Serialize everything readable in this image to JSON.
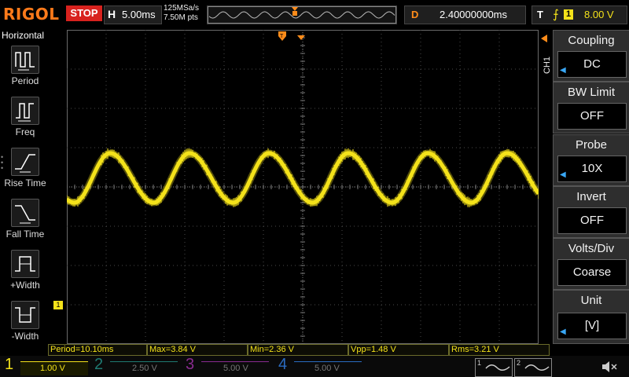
{
  "header": {
    "brand": "RIGOL",
    "run_state": "STOP",
    "horizontal_label": "H",
    "timebase": "5.00ms",
    "sample_rate": "125MSa/s",
    "points": "7.50M pts",
    "delay_label": "D",
    "delay_value": "2.40000000ms",
    "trigger_label": "T",
    "trigger_edge_icon": "rising-edge-icon",
    "trigger_channel": "1",
    "trigger_level": "8.00 V"
  },
  "left_panel": {
    "title": "Horizontal",
    "items": [
      {
        "label": "Period",
        "icon": "period-icon"
      },
      {
        "label": "Freq",
        "icon": "freq-icon"
      },
      {
        "label": "Rise Time",
        "icon": "rise-time-icon"
      },
      {
        "label": "Fall Time",
        "icon": "fall-time-icon"
      },
      {
        "label": "+Width",
        "icon": "positive-width-icon"
      },
      {
        "label": "-Width",
        "icon": "negative-width-icon"
      }
    ]
  },
  "right_menu": {
    "channel": "CH1",
    "items": [
      {
        "title": "Coupling",
        "value": "DC",
        "has_arrow": true
      },
      {
        "title": "BW Limit",
        "value": "OFF",
        "has_arrow": false
      },
      {
        "title": "Probe",
        "value": "10X",
        "has_arrow": true
      },
      {
        "title": "Invert",
        "value": "OFF",
        "has_arrow": false
      },
      {
        "title": "Volts/Div",
        "value": "Coarse",
        "has_arrow": false
      },
      {
        "title": "Unit",
        "value": "[V]",
        "has_arrow": true
      }
    ]
  },
  "channel1_marker": "1",
  "measurements": [
    {
      "text": "Period=10.10ms"
    },
    {
      "text": "Max=3.84 V"
    },
    {
      "text": "Min=2.36 V"
    },
    {
      "text": "Vpp=1.48 V"
    },
    {
      "text": "Rms=3.21 V"
    }
  ],
  "channels": [
    {
      "num": "1",
      "scale": "1.00 V",
      "color": "#f4e21a",
      "active": true
    },
    {
      "num": "2",
      "scale": "2.50 V",
      "color": "#1fb5a8",
      "active": false
    },
    {
      "num": "3",
      "scale": "5.00 V",
      "color": "#c03cc8",
      "active": false
    },
    {
      "num": "4",
      "scale": "5.00 V",
      "color": "#2a7bd8",
      "active": false
    }
  ],
  "math_labels": [
    "1",
    "2"
  ],
  "colors": {
    "ch1": "#f4e21a",
    "trigger_marker": "#ff8c1a",
    "stop": "#d8221e",
    "grid": "#4a4a4a"
  }
}
